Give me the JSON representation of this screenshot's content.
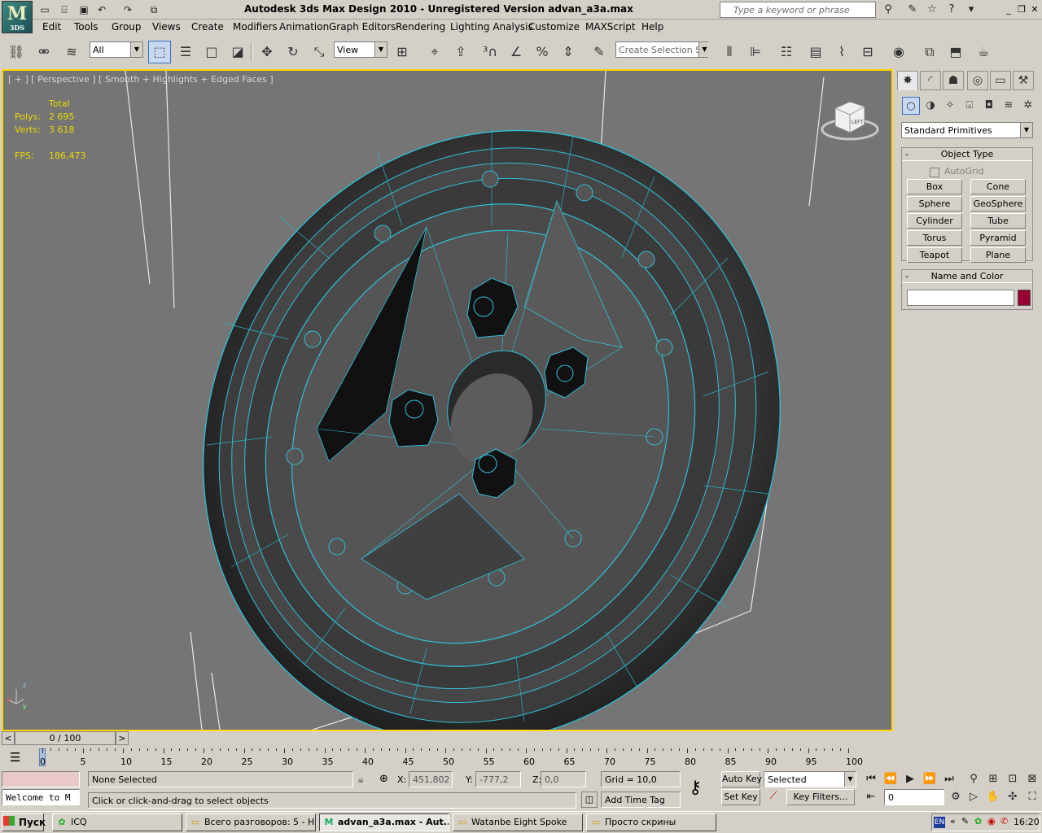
{
  "app": {
    "logo_text": "3DS",
    "title": "Autodesk 3ds Max Design 2010   -   Unregistered Version      advan_a3a.max"
  },
  "search": {
    "placeholder": "Type a keyword or phrase"
  },
  "menu": [
    "Edit",
    "Tools",
    "Group",
    "Views",
    "Create",
    "Modifiers",
    "Animation",
    "Graph Editors",
    "Rendering",
    "Lighting Analysis",
    "Customize",
    "MAXScript",
    "Help"
  ],
  "toolbar": {
    "filter_value": "All",
    "coord_value": "View",
    "selection_set_placeholder": "Create Selection Se"
  },
  "viewport": {
    "label": "[ + ] [ Perspective ] [ Smooth + Highlights + Edged Faces ]",
    "stats": {
      "total_label": "Total",
      "polys_label": "Polys:",
      "polys_value": "2 695",
      "verts_label": "Verts:",
      "verts_value": "3 618",
      "fps_label": "FPS:",
      "fps_value": "186,473"
    },
    "viewcube_face": "LEFT"
  },
  "command_panel": {
    "category": "Standard Primitives",
    "object_type_header": "Object Type",
    "autogrid_label": "AutoGrid",
    "primitives": [
      "Box",
      "Cone",
      "Sphere",
      "GeoSphere",
      "Cylinder",
      "Tube",
      "Torus",
      "Pyramid",
      "Teapot",
      "Plane"
    ],
    "name_color_header": "Name and Color",
    "color": "#990033"
  },
  "time_slider": {
    "position": "0 / 100"
  },
  "track_bar": {
    "ticks": [
      "0",
      "5",
      "10",
      "15",
      "20",
      "25",
      "30",
      "35",
      "40",
      "45",
      "50",
      "55",
      "60",
      "65",
      "70",
      "75",
      "80",
      "85",
      "90",
      "95",
      "100"
    ]
  },
  "status": {
    "maxscript_listener": "Welcome to M",
    "selection": "None Selected",
    "prompt": "Click or click-and-drag to select objects",
    "x_label": "X:",
    "x_value": "451,802",
    "y_label": "Y:",
    "y_value": "-777,2",
    "z_label": "Z:",
    "z_value": "0,0",
    "grid": "Grid = 10,0",
    "add_time_tag": "Add Time Tag",
    "auto_key": "Auto Key",
    "set_key": "Set Key",
    "key_mode": "Selected",
    "key_filters": "Key Filters...",
    "frame_value": "0"
  },
  "taskbar": {
    "start": "Пуск",
    "tasks": [
      "ICQ",
      "Всего разговоров: 5 - Н...",
      "advan_a3a.max - Aut...",
      "Watanbe Eight Spoke",
      "Просто скрины"
    ],
    "lang": "EN",
    "clock": "16:20"
  }
}
